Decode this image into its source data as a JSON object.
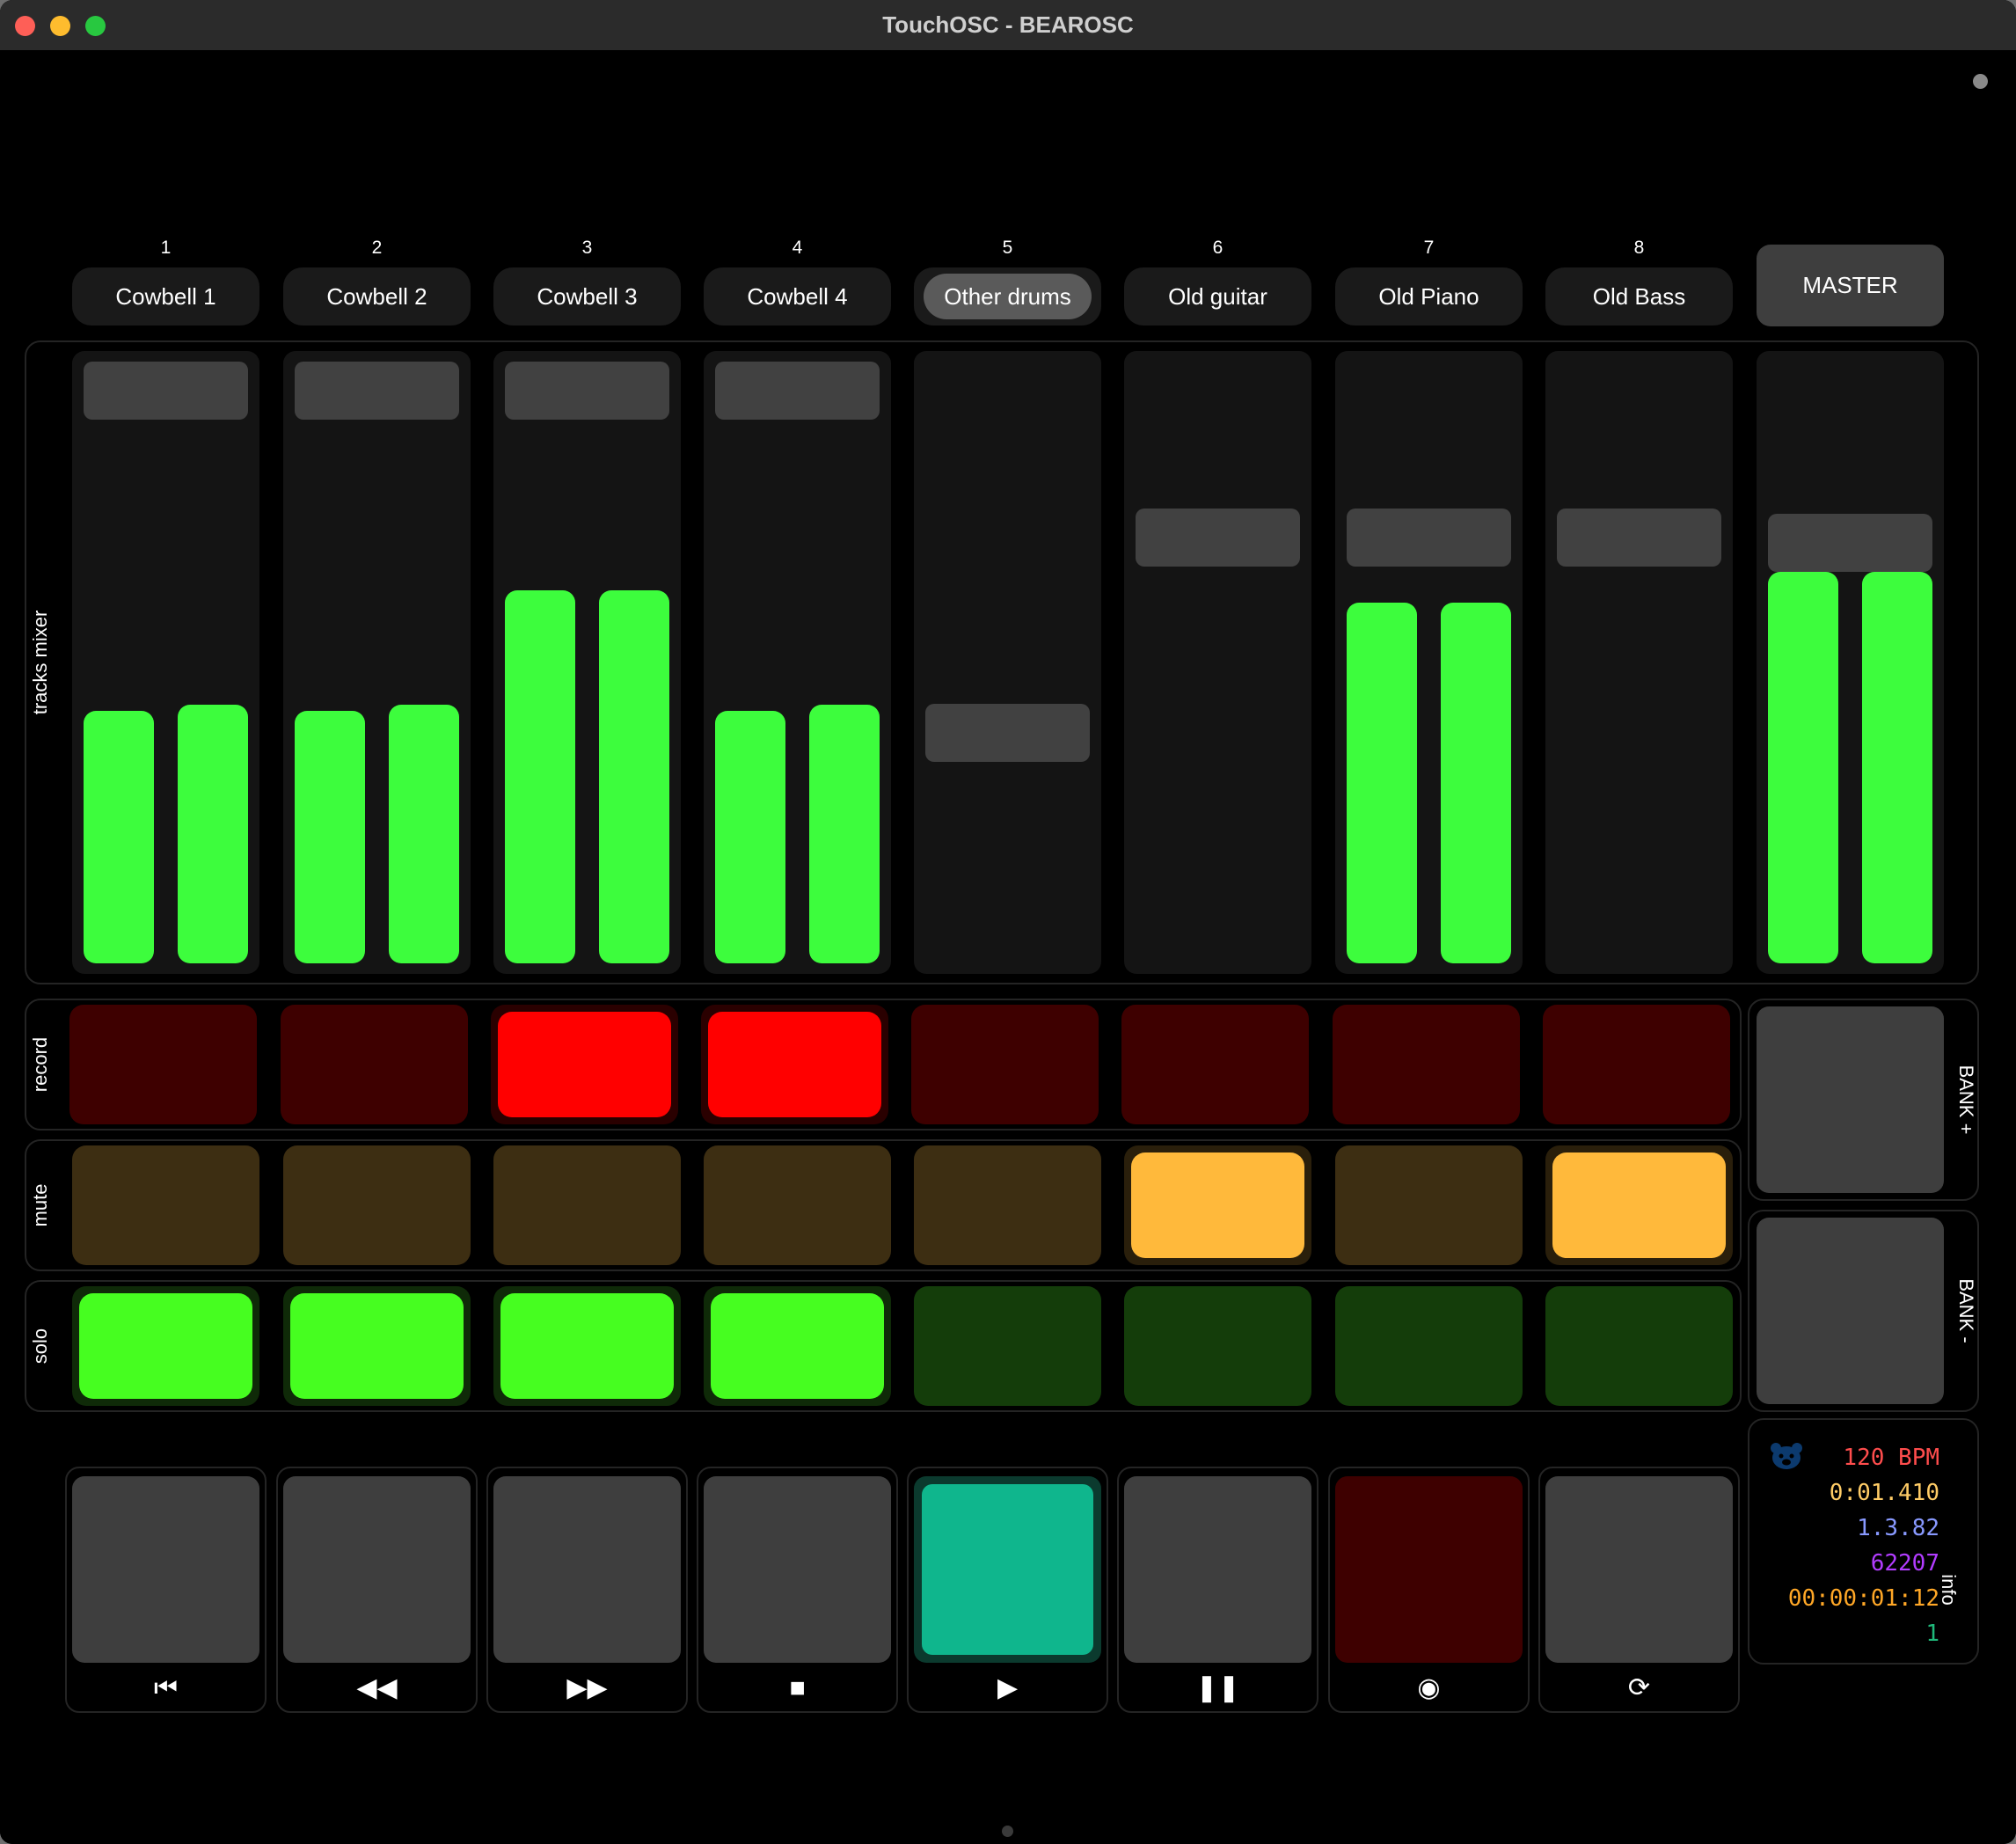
{
  "window": {
    "title": "TouchOSC - BEAROSC"
  },
  "sections": {
    "mixer": "tracks mixer",
    "record": "record",
    "mute": "mute",
    "solo": "solo",
    "info": "info"
  },
  "tracks": [
    {
      "num": "1",
      "name": "Cowbell 1",
      "selected": false,
      "fader": 0.0,
      "meterL": 0.42,
      "meterR": 0.43,
      "record": false,
      "mute": false,
      "solo": true
    },
    {
      "num": "2",
      "name": "Cowbell 2",
      "selected": false,
      "fader": 0.0,
      "meterL": 0.42,
      "meterR": 0.43,
      "record": false,
      "mute": false,
      "solo": true
    },
    {
      "num": "3",
      "name": "Cowbell 3",
      "selected": false,
      "fader": 0.0,
      "meterL": 0.62,
      "meterR": 0.62,
      "record": true,
      "mute": false,
      "solo": true
    },
    {
      "num": "4",
      "name": "Cowbell 4",
      "selected": false,
      "fader": 0.0,
      "meterL": 0.42,
      "meterR": 0.43,
      "record": true,
      "mute": false,
      "solo": true
    },
    {
      "num": "5",
      "name": "Other drums",
      "selected": true,
      "fader": 0.63,
      "meterL": 0.0,
      "meterR": 0.0,
      "record": false,
      "mute": false,
      "solo": false
    },
    {
      "num": "6",
      "name": "Old guitar",
      "selected": false,
      "fader": 0.27,
      "meterL": 0.0,
      "meterR": 0.0,
      "record": false,
      "mute": true,
      "solo": false
    },
    {
      "num": "7",
      "name": "Old Piano",
      "selected": false,
      "fader": 0.27,
      "meterL": 0.6,
      "meterR": 0.6,
      "record": false,
      "mute": false,
      "solo": false
    },
    {
      "num": "8",
      "name": "Old Bass",
      "selected": false,
      "fader": 0.27,
      "meterL": 0.0,
      "meterR": 0.0,
      "record": false,
      "mute": true,
      "solo": false
    }
  ],
  "master": {
    "label": "MASTER",
    "fader": 0.28,
    "meterL": 0.65,
    "meterR": 0.65
  },
  "bank": {
    "up": "BANK +",
    "down": "BANK -"
  },
  "transport": [
    {
      "name": "skip-to-start",
      "icon": "⏮",
      "active": false
    },
    {
      "name": "rewind",
      "icon": "◀◀",
      "active": false
    },
    {
      "name": "fast-forward",
      "icon": "▶▶",
      "active": false
    },
    {
      "name": "stop",
      "icon": "■",
      "active": false
    },
    {
      "name": "play",
      "icon": "▶",
      "active": true
    },
    {
      "name": "pause",
      "icon": "❚❚",
      "active": false
    },
    {
      "name": "record",
      "icon": "◉",
      "active": false
    },
    {
      "name": "loop",
      "icon": "⟳",
      "active": false
    }
  ],
  "info": {
    "bpm": "120 BPM",
    "time": "0:01.410",
    "beats": "1.3.82",
    "samples": "62207",
    "timecode": "00:00:01:12",
    "frames": "1"
  },
  "colors": {
    "meter": "#3dfd3d",
    "record_on": "#ff0000",
    "record_off": "#3e0000",
    "mute_on": "#ffb93b",
    "mute_off": "#3d2e12",
    "solo_on": "#46fe20",
    "solo_off": "#143d0a",
    "play_on": "#0fb68d",
    "info_bpm": "#ff4d4d",
    "info_time": "#ffcc66",
    "info_beats": "#8899ff",
    "info_samples": "#b23cff",
    "info_timecode": "#ffa726",
    "info_frames": "#1fb87a"
  }
}
